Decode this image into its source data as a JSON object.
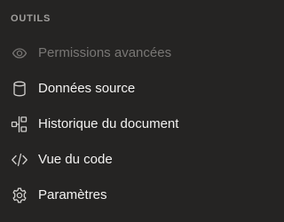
{
  "section": {
    "title": "OUTILS"
  },
  "menu": {
    "items": [
      {
        "label": "Permissions avancées",
        "icon": "eye-icon",
        "disabled": true
      },
      {
        "label": "Données source",
        "icon": "database-icon",
        "disabled": false
      },
      {
        "label": "Historique du document",
        "icon": "history-timeline-icon",
        "disabled": false
      },
      {
        "label": "Vue du code",
        "icon": "code-icon",
        "disabled": false
      },
      {
        "label": "Paramètres",
        "icon": "gear-icon",
        "disabled": false
      }
    ]
  },
  "colors": {
    "background": "#252423",
    "text": "#f3f2f1",
    "section_title": "#a19f9d",
    "disabled_text": "#797775",
    "icon": "#d2d0ce"
  }
}
